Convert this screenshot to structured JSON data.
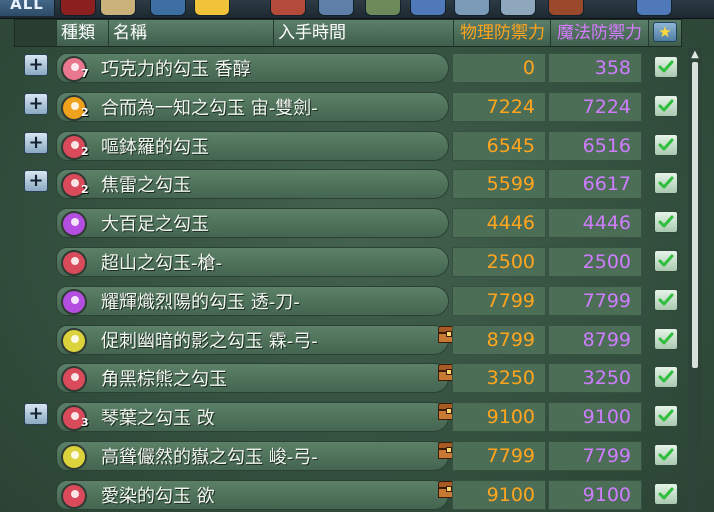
{
  "tabs": {
    "all_label": "ALL"
  },
  "header": {
    "kind": "種類",
    "name": "名稱",
    "time": "入手時間",
    "phys": "物理防禦力",
    "mag": "魔法防禦力"
  },
  "colors": {
    "phys": "#ffa51e",
    "mag": "#cf7dff",
    "pink": "#e9788e",
    "orange": "#f1a21c",
    "red_white": "#d94a5a",
    "purple": "#b34ee0",
    "yellow": "#dcd23c"
  },
  "rows": [
    {
      "expand": true,
      "icon": "pink-magatama-icon",
      "color": "#e9788e",
      "count": "7",
      "name": "巧克力的勾玉 香醇",
      "chest": false,
      "phys": "0",
      "mag": "358"
    },
    {
      "expand": true,
      "icon": "orange-magatama-icon",
      "color": "#f1a21c",
      "count": "2",
      "name": "合而為一知之勾玉 宙-雙劍-",
      "chest": false,
      "phys": "7224",
      "mag": "7224"
    },
    {
      "expand": true,
      "icon": "red-magatama-icon",
      "color": "#d94a5a",
      "count": "2",
      "name": "嘔鉢羅的勾玉",
      "chest": false,
      "phys": "6545",
      "mag": "6516"
    },
    {
      "expand": true,
      "icon": "red-magatama-icon",
      "color": "#d94a5a",
      "count": "2",
      "name": "焦雷之勾玉",
      "chest": false,
      "phys": "5599",
      "mag": "6617"
    },
    {
      "expand": false,
      "icon": "purple-magatama-icon",
      "color": "#b34ee0",
      "count": "",
      "name": "大百足之勾玉",
      "chest": false,
      "phys": "4446",
      "mag": "4446"
    },
    {
      "expand": false,
      "icon": "red-magatama-icon",
      "color": "#d94a5a",
      "count": "",
      "name": "超山之勾玉-槍-",
      "chest": false,
      "phys": "2500",
      "mag": "2500"
    },
    {
      "expand": false,
      "icon": "purple-magatama-icon",
      "color": "#b34ee0",
      "count": "",
      "name": "耀輝熾烈陽的勾玉 透-刀-",
      "chest": false,
      "phys": "7799",
      "mag": "7799"
    },
    {
      "expand": false,
      "icon": "yellow-magatama-icon",
      "color": "#dcd23c",
      "count": "",
      "name": "促刺幽暗的影之勾玉 霖-弓-",
      "chest": true,
      "phys": "8799",
      "mag": "8799"
    },
    {
      "expand": false,
      "icon": "red-magatama-icon",
      "color": "#d94a5a",
      "count": "",
      "name": "角黑棕熊之勾玉",
      "chest": true,
      "phys": "3250",
      "mag": "3250"
    },
    {
      "expand": true,
      "icon": "red-magatama-icon",
      "color": "#d94a5a",
      "count": "3",
      "name": "琴葉之勾玉 改",
      "chest": true,
      "phys": "9100",
      "mag": "9100"
    },
    {
      "expand": false,
      "icon": "yellow-magatama-icon",
      "color": "#dcd23c",
      "count": "",
      "name": "高聳儼然的嶽之勾玉 峻-弓-",
      "chest": true,
      "phys": "7799",
      "mag": "7799"
    },
    {
      "expand": false,
      "icon": "red-magatama-icon",
      "color": "#d94a5a",
      "count": "",
      "name": "愛染的勾玉 欲",
      "chest": true,
      "phys": "9100",
      "mag": "9100"
    }
  ]
}
